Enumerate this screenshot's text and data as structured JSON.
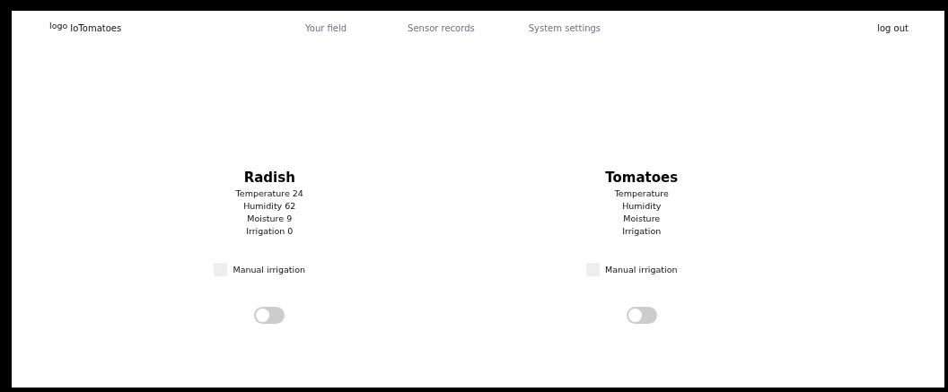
{
  "header": {
    "logo": "logo",
    "brand": "IoTomatoes",
    "nav": [
      {
        "label": "Your field",
        "selected": false
      },
      {
        "label": "Sensor records",
        "selected": false
      },
      {
        "label": "System settings",
        "selected": false
      }
    ],
    "logout": "log out"
  },
  "fields": [
    {
      "name": "Radish",
      "readings": [
        "Temperature 24",
        "Humidity 62",
        "Moisture 9",
        "Irrigation 0"
      ],
      "manual": {
        "label": "Manual irrigation",
        "checked": false
      },
      "switch": {
        "on": false
      }
    },
    {
      "name": "Tomatoes",
      "readings": [
        "Temperature",
        "Humidity",
        "Moisture",
        "Irrigation"
      ],
      "manual": {
        "label": "Manual irrigation",
        "checked": false
      },
      "switch": {
        "on": false
      }
    }
  ]
}
